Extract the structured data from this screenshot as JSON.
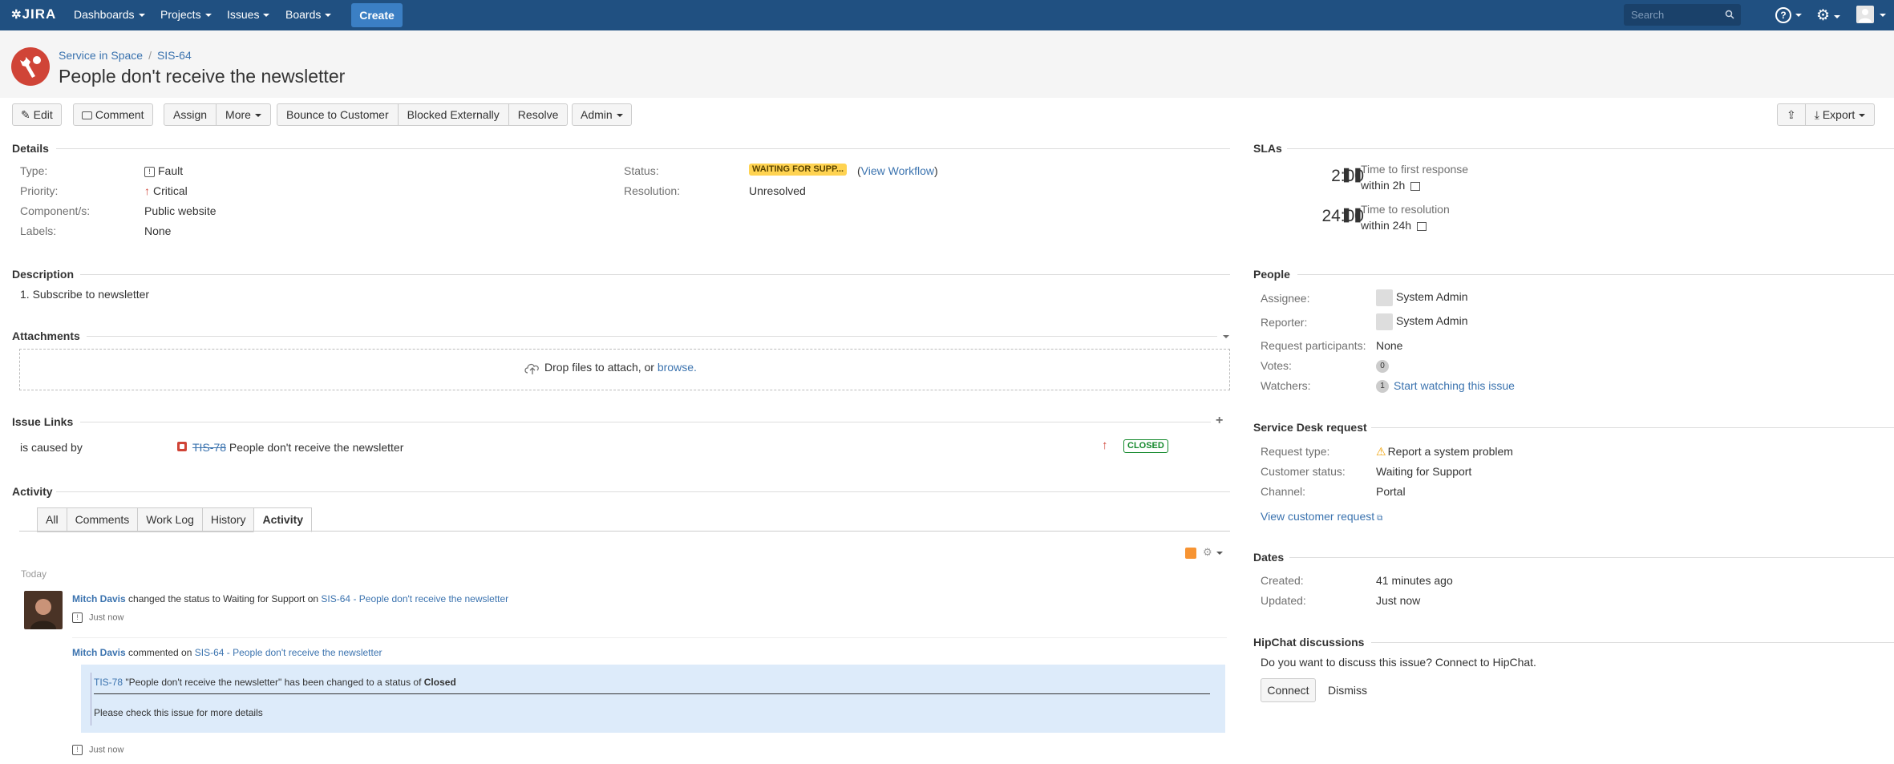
{
  "topbar": {
    "logo": "JIRA",
    "nav": [
      "Dashboards",
      "Projects",
      "Issues",
      "Boards"
    ],
    "create": "Create",
    "search_placeholder": "Search",
    "help": "?"
  },
  "issue": {
    "breadcrumb_project": "Service in Space",
    "breadcrumb_sep": "/",
    "key": "SIS-64",
    "title": "People don't receive the newsletter"
  },
  "toolbar": {
    "edit": "Edit",
    "comment": "Comment",
    "assign": "Assign",
    "more": "More",
    "bounce": "Bounce to Customer",
    "blocked": "Blocked Externally",
    "resolve": "Resolve",
    "admin": "Admin",
    "export": "Export"
  },
  "details": {
    "heading": "Details",
    "type_label": "Type:",
    "type_value": "Fault",
    "priority_label": "Priority:",
    "priority_value": "Critical",
    "components_label": "Component/s:",
    "components_value": "Public website",
    "labels_label": "Labels:",
    "labels_value": "None",
    "status_label": "Status:",
    "status_value": "WAITING FOR SUPP...",
    "view_workflow": "View Workflow",
    "resolution_label": "Resolution:",
    "resolution_value": "Unresolved"
  },
  "description": {
    "heading": "Description",
    "text": "1. Subscribe to newsletter"
  },
  "attachments": {
    "heading": "Attachments",
    "drop_text": "Drop files to attach, or",
    "browse": "browse."
  },
  "issue_links": {
    "heading": "Issue Links",
    "relation": "is caused by",
    "key": "TIS-78",
    "summary": "People don't receive the newsletter",
    "status": "CLOSED"
  },
  "activity": {
    "heading": "Activity",
    "tabs": [
      "All",
      "Comments",
      "Work Log",
      "History",
      "Activity"
    ],
    "day": "Today",
    "entry1_user": "Mitch Davis",
    "entry1_text": "changed the status to Waiting for Support on",
    "entry1_link": "SIS-64 - People don't receive the newsletter",
    "entry1_time": "Just now",
    "entry2_user": "Mitch Davis",
    "entry2_text": "commented on",
    "entry2_link": "SIS-64 - People don't receive the newsletter",
    "quote_key": "TIS-78",
    "quote_text": "\"People don't receive the newsletter\" has been changed to a status of",
    "quote_status": "Closed",
    "quote_body": "Please check this issue for more details",
    "entry2_time": "Just now"
  },
  "slas": {
    "heading": "SLAs",
    "items": [
      {
        "time": "2:00",
        "name": "Time to first response",
        "goal": "within 2h"
      },
      {
        "time": "24:00",
        "name": "Time to resolution",
        "goal": "within 24h"
      }
    ]
  },
  "people": {
    "heading": "People",
    "assignee_label": "Assignee:",
    "assignee": "System Admin",
    "reporter_label": "Reporter:",
    "reporter": "System Admin",
    "participants_label": "Request participants:",
    "participants": "None",
    "votes_label": "Votes:",
    "votes": "0",
    "watchers_label": "Watchers:",
    "watchers": "1",
    "watch_link": "Start watching this issue"
  },
  "service_desk": {
    "heading": "Service Desk request",
    "request_type_label": "Request type:",
    "request_type": "Report a system problem",
    "customer_status_label": "Customer status:",
    "customer_status": "Waiting for Support",
    "channel_label": "Channel:",
    "channel": "Portal",
    "view_link": "View customer request"
  },
  "dates": {
    "heading": "Dates",
    "created_label": "Created:",
    "created": "41 minutes ago",
    "updated_label": "Updated:",
    "updated": "Just now"
  },
  "hipchat": {
    "heading": "HipChat discussions",
    "prompt": "Do you want to discuss this issue? Connect to HipChat.",
    "connect": "Connect",
    "dismiss": "Dismiss"
  },
  "colors": {
    "topbar": "#205081",
    "link": "#3b73af",
    "status_badge": "#ffd351",
    "closed": "#14892c",
    "priority": "#d04437"
  }
}
